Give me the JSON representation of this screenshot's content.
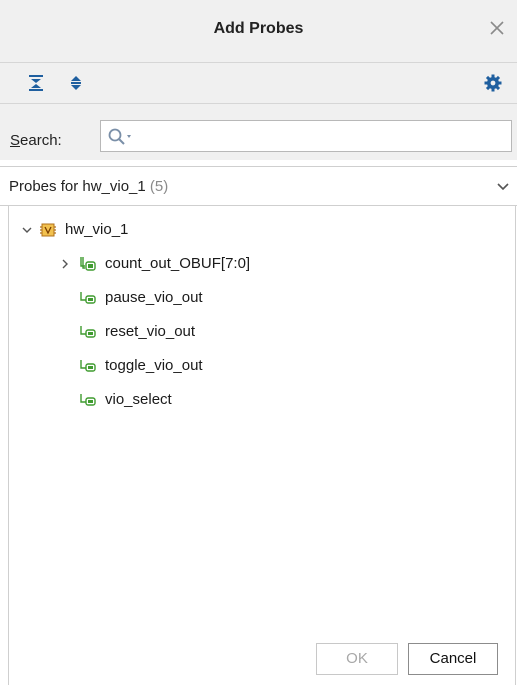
{
  "window": {
    "title": "Add Probes",
    "close_icon": "close-icon"
  },
  "toolbar": {
    "collapse_all_icon": "collapse-all-icon",
    "expand_all_icon": "expand-all-icon",
    "settings_icon": "gear-icon"
  },
  "search": {
    "label": "Search:",
    "mnemonic": "S",
    "value": "",
    "placeholder": ""
  },
  "probes_dropdown": {
    "label": "Probes for hw_vio_1",
    "count": "(5)"
  },
  "tree": {
    "root": {
      "label": "hw_vio_1",
      "expanded": true,
      "icon": "vio-core-icon"
    },
    "items": [
      {
        "label": "count_out_OBUF[7:0]",
        "icon": "bus-probe-icon",
        "expandable": true
      },
      {
        "label": "pause_vio_out",
        "icon": "signal-probe-icon",
        "expandable": false
      },
      {
        "label": "reset_vio_out",
        "icon": "signal-probe-icon",
        "expandable": false
      },
      {
        "label": "toggle_vio_out",
        "icon": "signal-probe-icon",
        "expandable": false
      },
      {
        "label": "vio_select",
        "icon": "signal-probe-icon",
        "expandable": false
      }
    ]
  },
  "buttons": {
    "ok": "OK",
    "cancel": "Cancel",
    "ok_enabled": false
  },
  "colors": {
    "probe_green": "#3f9b2f",
    "vio_orange": "#d88a1b",
    "toolbar_blue": "#1f5f9f"
  }
}
